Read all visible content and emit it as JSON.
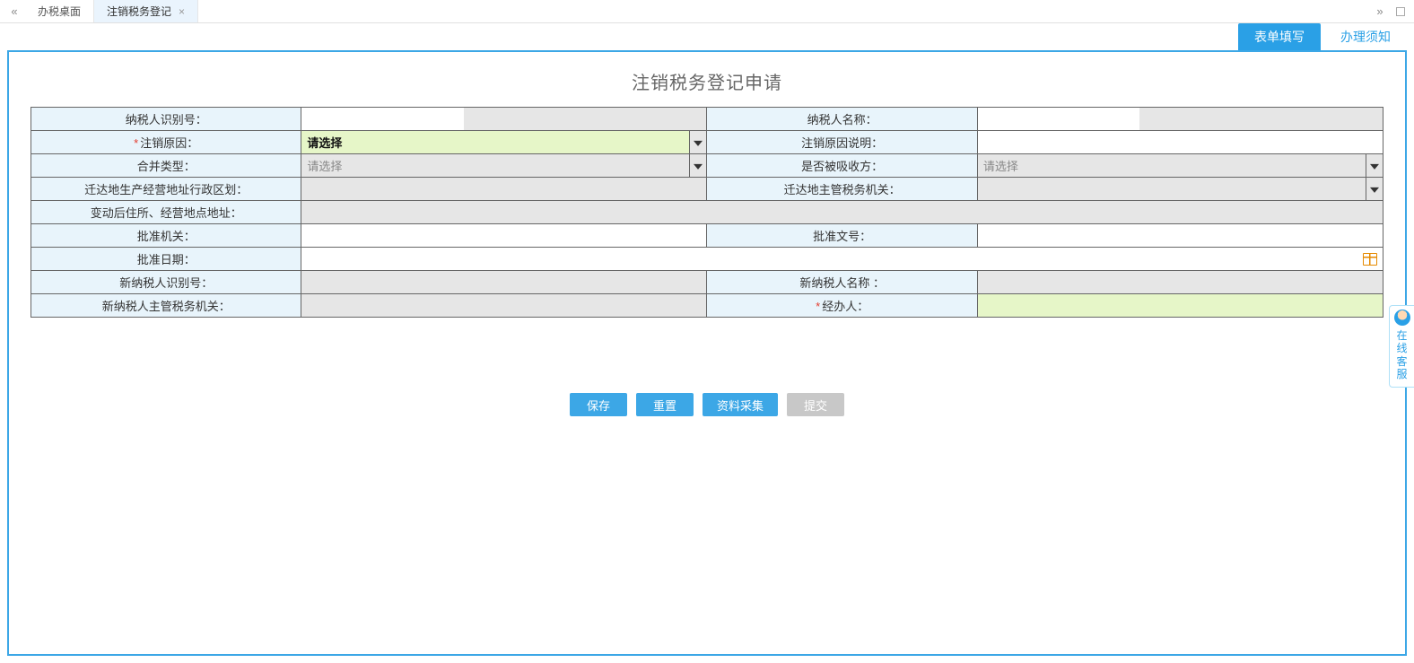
{
  "tabs": {
    "prev_glyph": "«",
    "next_glyph": "»",
    "items": [
      {
        "label": "办税桌面",
        "active": false,
        "closable": false
      },
      {
        "label": "注销税务登记",
        "active": true,
        "closable": true
      }
    ]
  },
  "subtabs": {
    "form_fill": "表单填写",
    "notice": "办理须知"
  },
  "page_title": "注销税务登记申请",
  "placeholders": {
    "please_select": "请选择"
  },
  "form": {
    "taxpayer_id_label": "纳税人识别号：",
    "taxpayer_id_value": "",
    "taxpayer_name_label": "纳税人名称：",
    "taxpayer_name_value": "",
    "cancel_reason_label": "注销原因：",
    "cancel_reason_value": "请选择",
    "cancel_reason_desc_label": "注销原因说明：",
    "cancel_reason_desc_value": "",
    "merge_type_label": "合并类型：",
    "merge_type_value": "",
    "absorbed_label": "是否被吸收方：",
    "absorbed_value": "",
    "relocate_region_label": "迁达地生产经营地址行政区划：",
    "relocate_region_value": "",
    "relocate_tax_office_label": "迁达地主管税务机关：",
    "relocate_tax_office_value": "",
    "changed_addr_label": "变动后住所、经营地点地址：",
    "changed_addr_value": "",
    "approve_org_label": "批准机关：",
    "approve_org_value": "",
    "approve_doc_label": "批准文号：",
    "approve_doc_value": "",
    "approve_date_label": "批准日期：",
    "approve_date_value": "",
    "new_taxpayer_id_label": "新纳税人识别号：",
    "new_taxpayer_id_value": "",
    "new_taxpayer_name_label": "新纳税人名称 ：",
    "new_taxpayer_name_value": "",
    "new_tax_office_label": "新纳税人主管税务机关：",
    "new_tax_office_value": "",
    "handler_label": "经办人：",
    "handler_value": ""
  },
  "buttons": {
    "save": "保存",
    "reset": "重置",
    "collect": "资料采集",
    "submit": "提交"
  },
  "helper": "在线客服"
}
